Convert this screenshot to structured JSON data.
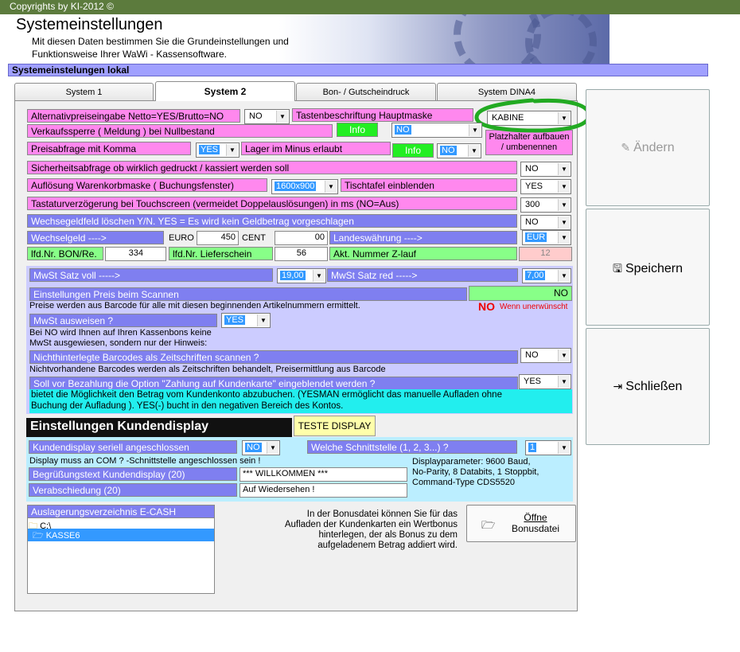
{
  "top_bar": {
    "text": "Copyrights by KI-2012 ©"
  },
  "header": {
    "title": "Systemeinstellungen",
    "subtitle_line1": "Mit diesen Daten bestimmen Sie die Grundeinstellungen und",
    "subtitle_line2": "Funktionsweise Ihrer WaWi - Kassensoftware."
  },
  "section": {
    "title": "Systemeinstelungen lokal"
  },
  "tabs": [
    "System 1",
    "System 2",
    "Bon- / Gutscheindruck",
    "System DINA4"
  ],
  "rows": {
    "alt_price": {
      "label": "Alternativpreiseingabe Netto=YES/Brutto=NO",
      "value": "NO"
    },
    "key_label": {
      "label": "Tastenbeschriftung Hauptmaske",
      "value": "KABINE"
    },
    "placeholder": {
      "label": "Platzhalter aufbauen / umbenennen"
    },
    "sales_lock": {
      "label": "Verkaufssperre ( Meldung ) bei Nullbestand",
      "info": "Info",
      "value": "NO"
    },
    "price_query": {
      "label": "Preisabfrage mit Komma",
      "value": "YES"
    },
    "stock_minus": {
      "label": "Lager im Minus erlaubt",
      "info": "Info",
      "value": "NO"
    },
    "security": {
      "label": "Sicherheitsabfrage ob wirklich gedruckt / kassiert werden soll",
      "value": "NO"
    },
    "resolution": {
      "label": "Auflösung Warenkorbmaske  ( Buchungsfenster)",
      "value": "1600x900"
    },
    "table_show": {
      "label": "Tischtafel einblenden",
      "value": "YES"
    },
    "keyboard_delay": {
      "label": "Tastaturverzögerung bei Touchscreen (vermeidet Doppelauslösungen) in ms (NO=Aus)",
      "value": "300"
    },
    "change_field": {
      "label": "Wechsegeldfeld löschen Y/N. YES = Es wird kein Geldbetrag vorgeschlagen",
      "value": "NO"
    },
    "change": {
      "label": "Wechselgeld ---->",
      "euro_label": "EURO",
      "euro_value": "450",
      "cent_label": "CENT",
      "cent_value": "00"
    },
    "currency": {
      "label": "Landeswährung ---->",
      "value": "EUR"
    },
    "bon_nr": {
      "label": "lfd.Nr. BON/Re.",
      "value": "334"
    },
    "delivery_nr": {
      "label": "lfd.Nr. Lieferschein",
      "value": "56"
    },
    "z_nr": {
      "label": "Akt. Nummer Z-lauf",
      "value": "12"
    }
  },
  "vat": {
    "full_label": "MwSt Satz voll ----->",
    "full_value": "19,00",
    "reduced_label": "MwSt Satz red ----->",
    "reduced_value": "7,00"
  },
  "scan": {
    "label": "Einstellungen Preis beim Scannen",
    "value": "NO",
    "note": "Preise werden aus Barcode für alle mit diesen beginnenden Artikelnummern ermittelt.",
    "no_label": "NO",
    "unwanted": "Wenn unerwünscht"
  },
  "vat_show": {
    "label": "MwSt ausweisen  ?",
    "value": "YES",
    "note1": "Bei NO wird Ihnen auf Ihren Kassenbons keine",
    "note2": "MwSt ausgewiesen, sondern nur der Hinweis:"
  },
  "barcode": {
    "label": "Nichthinterlegte Barcodes als Zeitschriften scannen ?",
    "value": "NO",
    "note": "Nichtvorhandene Barcodes werden als Zeitschriften behandelt, Preisermittlung aus Barcode"
  },
  "payment": {
    "label": "Soll vor Bezahlung die Option \"Zahlung auf Kundenkarte\" eingeblendet werden ?",
    "value": "YES",
    "note1": "bietet die Möglichkeit den Betrag  vom Kundenkonto abzubuchen. (YESMAN ermöglicht das manuelle Aufladen ohne",
    "note2": "Buchung der Aufladung ). YES(-) bucht in den negativen Bereich des Kontos."
  },
  "display": {
    "title": "Einstellungen Kundendisplay",
    "test_button": "TESTE DISPLAY",
    "serial_label": "Kundendisplay seriell angeschlossen",
    "serial_value": "NO",
    "port_label": "Welche Schnittstelle (1, 2, 3...) ?",
    "port_value": "1",
    "com_note": "Display muss an COM ? -Schnittstelle angeschlossen sein !",
    "params1": "Displayparameter: 9600 Baud,",
    "params2": "No-Parity, 8 Databits, 1 Stoppbit,",
    "params3": "Command-Type CDS5520",
    "greeting_label": "Begrüßungstext Kundendisplay (20)",
    "greeting_value": "*** WILLKOMMEN ***",
    "farewell_label": "Verabschiedung (20)",
    "farewell_value": "Auf Wiedersehen !"
  },
  "ecash": {
    "label": "Auslagerungsverzeichnis E-CASH",
    "dirs": [
      "C:\\",
      "KASSE6"
    ]
  },
  "bonus": {
    "note1": "In der Bonusdatei können Sie für das",
    "note2": "Aufladen der Kundenkarten ein Wertbonus",
    "note3": "hinterlegen, der als Bonus zu dem",
    "note4": "aufgeladenem Betrag  addiert wird.",
    "button_line1": "Öffne",
    "button_line2": "Bonusdatei"
  },
  "side": {
    "change": "Ändern",
    "save": "Speichern",
    "close": "Schließen"
  },
  "colors": {
    "pink": "#ff88ee",
    "blue": "#7f7ff0",
    "green": "#88ff88",
    "lavender": "#ccccff",
    "cyan": "#22eeee",
    "annotation": "#22aa22"
  }
}
